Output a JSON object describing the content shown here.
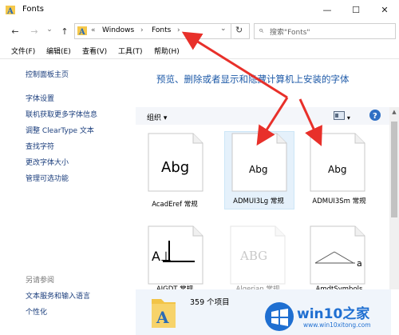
{
  "window": {
    "title": "Fonts",
    "minimize_glyph": "—",
    "maximize_glyph": "☐",
    "close_glyph": "✕"
  },
  "nav": {
    "back_glyph": "←",
    "forward_glyph": "→",
    "dropdown_glyph": "⌄",
    "up_glyph": "↑",
    "breadcrumb_prefix": "«",
    "breadcrumb": [
      "Windows",
      "Fonts"
    ],
    "separator": "›",
    "refresh_glyph": "↻",
    "search_placeholder": "搜索\"Fonts\"",
    "search_glyph": "⌕"
  },
  "menu": [
    "文件(F)",
    "编辑(E)",
    "查看(V)",
    "工具(T)",
    "帮助(H)"
  ],
  "sidebar": {
    "home": "控制面板主页",
    "links": [
      "字体设置",
      "联机获取更多字体信息",
      "调整 ClearType 文本",
      "查找字符",
      "更改字体大小",
      "管理可选功能"
    ],
    "see_also_heading": "另请参阅",
    "see_also": [
      "文本服务和输入语言",
      "个性化"
    ]
  },
  "main": {
    "title": "预览、删除或者显示和隐藏计算机上安装的字体",
    "organize_label": "组织",
    "organize_arrow": "▾",
    "fonts": [
      {
        "name": "AcadEref 常规",
        "sample": "Abg",
        "selected": false,
        "hidden": false
      },
      {
        "name": "ADMUI3Lg 常规",
        "sample": "Abg",
        "selected": true,
        "hidden": false
      },
      {
        "name": "ADMUI3Sm 常规",
        "sample": "Abg",
        "selected": false,
        "hidden": false
      },
      {
        "name": "AIGDT 常规",
        "sample": "A⊥",
        "selected": false,
        "hidden": false
      },
      {
        "name": "Algerian 常规",
        "sample": "ABG",
        "selected": false,
        "hidden": true
      },
      {
        "name": "AmdtSymbols",
        "sample": "",
        "selected": false,
        "hidden": false
      }
    ],
    "status_count": "359 个项目"
  },
  "watermark": {
    "brand": "win10之家",
    "url": "www.win10xitong.com"
  },
  "colors": {
    "accent": "#1e5aa8",
    "arrow": "#e8302a"
  }
}
